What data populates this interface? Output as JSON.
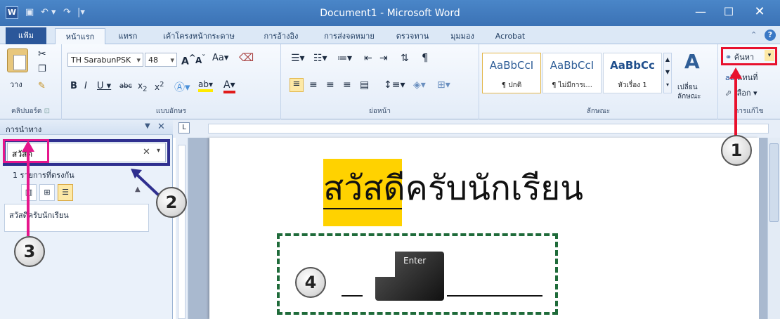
{
  "titlebar": {
    "title": "Document1 - Microsoft Word",
    "logo": "W"
  },
  "tabs": [
    "แฟ้ม",
    "หน้าแรก",
    "แทรก",
    "เค้าโครงหน้ากระดาษ",
    "การอ้างอิง",
    "การส่งจดหมาย",
    "ตรวจทาน",
    "มุมมอง",
    "Acrobat"
  ],
  "clipboard": {
    "paste": "วาง",
    "label": "คลิปบอร์ด"
  },
  "font": {
    "name": "TH SarabunPSK",
    "size": "48",
    "label": "แบบอักษร"
  },
  "paragraph": {
    "label": "ย่อหน้า"
  },
  "styles": {
    "items": [
      {
        "preview": "AaBbCcI",
        "name": "¶ ปกติ"
      },
      {
        "preview": "AaBbCcI",
        "name": "¶ ไม่มีการเ..."
      },
      {
        "preview": "AaBbCc",
        "name": "หัวเรื่อง 1"
      }
    ],
    "change": "เปลี่ยน",
    "change2": "ลักษณะ",
    "label": "ลักษณะ"
  },
  "editing": {
    "find": "ค้นหา",
    "replace": "แทนที่",
    "select": "เลือก",
    "label": "การแก้ไข"
  },
  "nav": {
    "title": "การนำทาง",
    "search_value": "สวัสดี",
    "results": "1 รายการที่ตรงกัน",
    "result_item": "สวัสดีครับนักเรียน"
  },
  "document": {
    "text_highlight": "สวัสดี",
    "text_rest": "ครับนักเรียน",
    "enter_key": "Enter"
  },
  "callouts": [
    "1",
    "2",
    "3",
    "4"
  ],
  "colors": {
    "accent": "#2b579a",
    "highlight": "#ffd200",
    "callout_red": "#e8112d",
    "callout_pink": "#e6168c",
    "callout_navy": "#2f2f8f",
    "dash_green": "#1f6b3a"
  }
}
